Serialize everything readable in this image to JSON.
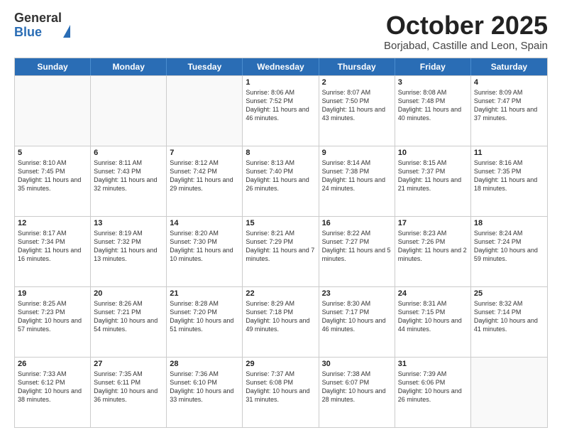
{
  "logo": {
    "line1": "General",
    "line2": "Blue"
  },
  "title": {
    "month_year": "October 2025",
    "location": "Borjabad, Castille and Leon, Spain"
  },
  "header_days": [
    "Sunday",
    "Monday",
    "Tuesday",
    "Wednesday",
    "Thursday",
    "Friday",
    "Saturday"
  ],
  "weeks": [
    [
      {
        "date": "",
        "sunrise": "",
        "sunset": "",
        "daylight": ""
      },
      {
        "date": "",
        "sunrise": "",
        "sunset": "",
        "daylight": ""
      },
      {
        "date": "",
        "sunrise": "",
        "sunset": "",
        "daylight": ""
      },
      {
        "date": "1",
        "sunrise": "Sunrise: 8:06 AM",
        "sunset": "Sunset: 7:52 PM",
        "daylight": "Daylight: 11 hours and 46 minutes."
      },
      {
        "date": "2",
        "sunrise": "Sunrise: 8:07 AM",
        "sunset": "Sunset: 7:50 PM",
        "daylight": "Daylight: 11 hours and 43 minutes."
      },
      {
        "date": "3",
        "sunrise": "Sunrise: 8:08 AM",
        "sunset": "Sunset: 7:48 PM",
        "daylight": "Daylight: 11 hours and 40 minutes."
      },
      {
        "date": "4",
        "sunrise": "Sunrise: 8:09 AM",
        "sunset": "Sunset: 7:47 PM",
        "daylight": "Daylight: 11 hours and 37 minutes."
      }
    ],
    [
      {
        "date": "5",
        "sunrise": "Sunrise: 8:10 AM",
        "sunset": "Sunset: 7:45 PM",
        "daylight": "Daylight: 11 hours and 35 minutes."
      },
      {
        "date": "6",
        "sunrise": "Sunrise: 8:11 AM",
        "sunset": "Sunset: 7:43 PM",
        "daylight": "Daylight: 11 hours and 32 minutes."
      },
      {
        "date": "7",
        "sunrise": "Sunrise: 8:12 AM",
        "sunset": "Sunset: 7:42 PM",
        "daylight": "Daylight: 11 hours and 29 minutes."
      },
      {
        "date": "8",
        "sunrise": "Sunrise: 8:13 AM",
        "sunset": "Sunset: 7:40 PM",
        "daylight": "Daylight: 11 hours and 26 minutes."
      },
      {
        "date": "9",
        "sunrise": "Sunrise: 8:14 AM",
        "sunset": "Sunset: 7:38 PM",
        "daylight": "Daylight: 11 hours and 24 minutes."
      },
      {
        "date": "10",
        "sunrise": "Sunrise: 8:15 AM",
        "sunset": "Sunset: 7:37 PM",
        "daylight": "Daylight: 11 hours and 21 minutes."
      },
      {
        "date": "11",
        "sunrise": "Sunrise: 8:16 AM",
        "sunset": "Sunset: 7:35 PM",
        "daylight": "Daylight: 11 hours and 18 minutes."
      }
    ],
    [
      {
        "date": "12",
        "sunrise": "Sunrise: 8:17 AM",
        "sunset": "Sunset: 7:34 PM",
        "daylight": "Daylight: 11 hours and 16 minutes."
      },
      {
        "date": "13",
        "sunrise": "Sunrise: 8:19 AM",
        "sunset": "Sunset: 7:32 PM",
        "daylight": "Daylight: 11 hours and 13 minutes."
      },
      {
        "date": "14",
        "sunrise": "Sunrise: 8:20 AM",
        "sunset": "Sunset: 7:30 PM",
        "daylight": "Daylight: 11 hours and 10 minutes."
      },
      {
        "date": "15",
        "sunrise": "Sunrise: 8:21 AM",
        "sunset": "Sunset: 7:29 PM",
        "daylight": "Daylight: 11 hours and 7 minutes."
      },
      {
        "date": "16",
        "sunrise": "Sunrise: 8:22 AM",
        "sunset": "Sunset: 7:27 PM",
        "daylight": "Daylight: 11 hours and 5 minutes."
      },
      {
        "date": "17",
        "sunrise": "Sunrise: 8:23 AM",
        "sunset": "Sunset: 7:26 PM",
        "daylight": "Daylight: 11 hours and 2 minutes."
      },
      {
        "date": "18",
        "sunrise": "Sunrise: 8:24 AM",
        "sunset": "Sunset: 7:24 PM",
        "daylight": "Daylight: 10 hours and 59 minutes."
      }
    ],
    [
      {
        "date": "19",
        "sunrise": "Sunrise: 8:25 AM",
        "sunset": "Sunset: 7:23 PM",
        "daylight": "Daylight: 10 hours and 57 minutes."
      },
      {
        "date": "20",
        "sunrise": "Sunrise: 8:26 AM",
        "sunset": "Sunset: 7:21 PM",
        "daylight": "Daylight: 10 hours and 54 minutes."
      },
      {
        "date": "21",
        "sunrise": "Sunrise: 8:28 AM",
        "sunset": "Sunset: 7:20 PM",
        "daylight": "Daylight: 10 hours and 51 minutes."
      },
      {
        "date": "22",
        "sunrise": "Sunrise: 8:29 AM",
        "sunset": "Sunset: 7:18 PM",
        "daylight": "Daylight: 10 hours and 49 minutes."
      },
      {
        "date": "23",
        "sunrise": "Sunrise: 8:30 AM",
        "sunset": "Sunset: 7:17 PM",
        "daylight": "Daylight: 10 hours and 46 minutes."
      },
      {
        "date": "24",
        "sunrise": "Sunrise: 8:31 AM",
        "sunset": "Sunset: 7:15 PM",
        "daylight": "Daylight: 10 hours and 44 minutes."
      },
      {
        "date": "25",
        "sunrise": "Sunrise: 8:32 AM",
        "sunset": "Sunset: 7:14 PM",
        "daylight": "Daylight: 10 hours and 41 minutes."
      }
    ],
    [
      {
        "date": "26",
        "sunrise": "Sunrise: 7:33 AM",
        "sunset": "Sunset: 6:12 PM",
        "daylight": "Daylight: 10 hours and 38 minutes."
      },
      {
        "date": "27",
        "sunrise": "Sunrise: 7:35 AM",
        "sunset": "Sunset: 6:11 PM",
        "daylight": "Daylight: 10 hours and 36 minutes."
      },
      {
        "date": "28",
        "sunrise": "Sunrise: 7:36 AM",
        "sunset": "Sunset: 6:10 PM",
        "daylight": "Daylight: 10 hours and 33 minutes."
      },
      {
        "date": "29",
        "sunrise": "Sunrise: 7:37 AM",
        "sunset": "Sunset: 6:08 PM",
        "daylight": "Daylight: 10 hours and 31 minutes."
      },
      {
        "date": "30",
        "sunrise": "Sunrise: 7:38 AM",
        "sunset": "Sunset: 6:07 PM",
        "daylight": "Daylight: 10 hours and 28 minutes."
      },
      {
        "date": "31",
        "sunrise": "Sunrise: 7:39 AM",
        "sunset": "Sunset: 6:06 PM",
        "daylight": "Daylight: 10 hours and 26 minutes."
      },
      {
        "date": "",
        "sunrise": "",
        "sunset": "",
        "daylight": ""
      }
    ]
  ]
}
